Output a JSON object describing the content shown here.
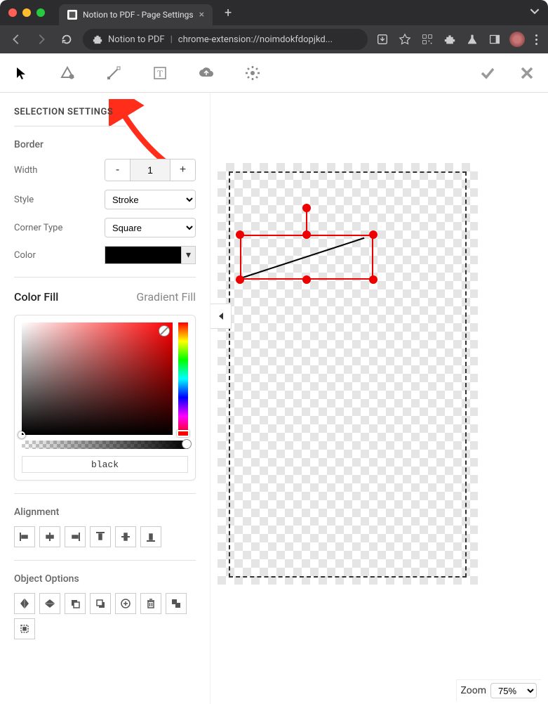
{
  "browser": {
    "tab_title": "Notion to PDF - Page Settings",
    "url_prefix": "Notion to PDF",
    "url": "chrome-extension://noimdokfdopjkd..."
  },
  "panel": {
    "title": "SELECTION SETTINGS",
    "border": {
      "section": "Border",
      "width_label": "Width",
      "width_value": "1",
      "style_label": "Style",
      "style_value": "Stroke",
      "corner_label": "Corner Type",
      "corner_value": "Square",
      "color_label": "Color",
      "color_value": "#000000"
    },
    "fill": {
      "tab_active": "Color Fill",
      "tab_inactive": "Gradient Fill",
      "color_name": "black"
    },
    "alignment": {
      "section": "Alignment"
    },
    "object_options": {
      "section": "Object Options"
    }
  },
  "zoom": {
    "label": "Zoom",
    "value": "75%"
  }
}
